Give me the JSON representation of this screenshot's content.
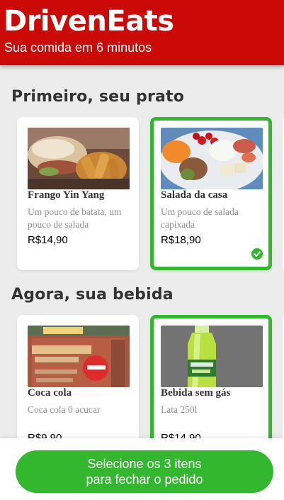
{
  "header": {
    "title": "DrivenEats",
    "subtitle": "Sua comida em 6 minutos"
  },
  "sections": [
    {
      "title": "Primeiro, seu prato",
      "items": [
        {
          "name": "Frango Yin Yang",
          "description": "Um pouco de batata, um pouco de salada",
          "price": "R$14,90",
          "selected": false
        },
        {
          "name": "Salada da casa",
          "description": "Um pouco de salada capixada",
          "price": "R$18,90",
          "selected": true
        }
      ]
    },
    {
      "title": "Agora, sua bebida",
      "items": [
        {
          "name": "Coca cola",
          "description": "Coca cola 0 acucar",
          "price": "R$9.90",
          "selected": false
        },
        {
          "name": "Bebida sem gás",
          "description": "Lata 250l",
          "price": "R$14.90",
          "selected": true
        }
      ]
    }
  ],
  "footer": {
    "button_line1": "Selecione os 3 itens",
    "button_line2": "para fechar o pedido"
  },
  "colors": {
    "brand_red": "#cb0a08",
    "accent_green": "#32b72f",
    "background": "#ececec"
  },
  "icons": {
    "selected_marker": "check-circle-icon"
  }
}
